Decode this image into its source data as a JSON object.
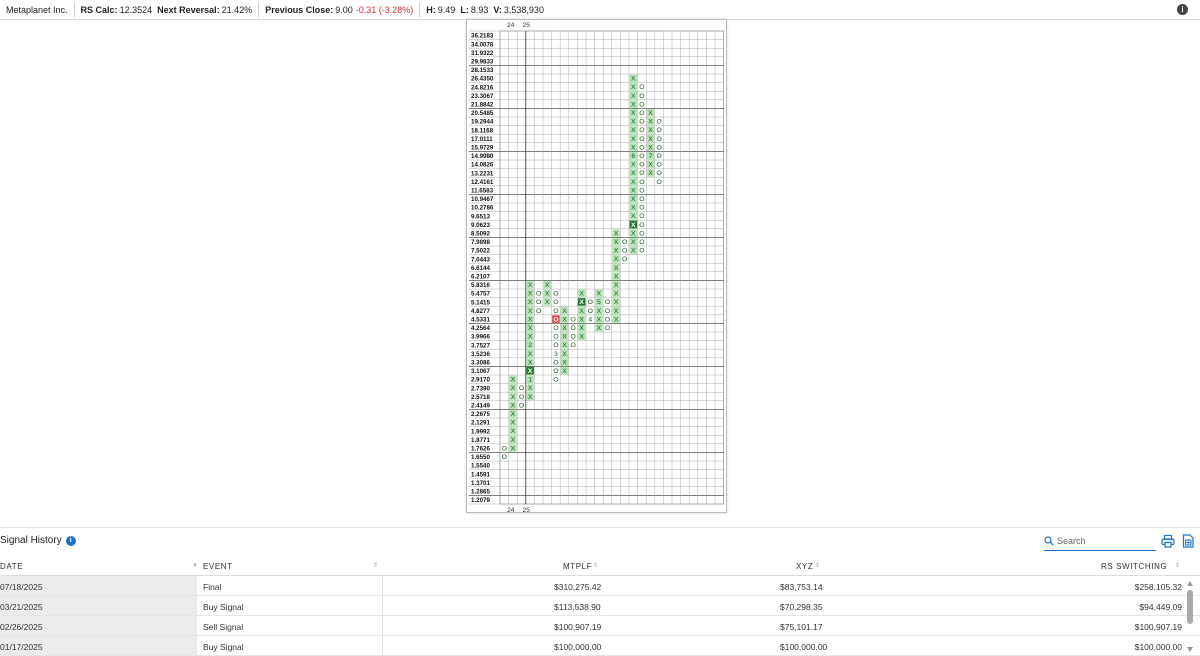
{
  "header": {
    "company": "Metaplanet Inc.",
    "rs_calc_label": "RS Calc:",
    "rs_calc_value": "12.3524",
    "next_reversal_label": "Next Reversal:",
    "next_reversal_value": "21.42%",
    "prev_close_label": "Previous Close:",
    "prev_close_value": "9.00",
    "prev_close_change": "-0.31 (-3.28%)",
    "high_label": "H:",
    "high_value": "9.49",
    "low_label": "L:",
    "low_value": "8.93",
    "volume_label": "V:",
    "volume_value": "3,538,930"
  },
  "chart_data": {
    "type": "point-and-figure",
    "year_labels": [
      "24",
      "25"
    ],
    "price_levels": [
      "36.2183",
      "34.0078",
      "31.9322",
      "29.9833",
      "28.1533",
      "26.4350",
      "24.8216",
      "23.3067",
      "21.8842",
      "20.5485",
      "19.2944",
      "18.1168",
      "17.0111",
      "15.9729",
      "14.9980",
      "14.0826",
      "13.2231",
      "12.4161",
      "11.6583",
      "10.9467",
      "10.2786",
      "9.6513",
      "9.0623",
      "8.5092",
      "7.9898",
      "7.5022",
      "7.0443",
      "6.6144",
      "6.2107",
      "5.8316",
      "5.4757",
      "5.1415",
      "4.8277",
      "4.5331",
      "4.2564",
      "3.9966",
      "3.7527",
      "3.5236",
      "3.3086",
      "3.1067",
      "2.9170",
      "2.7390",
      "2.5718",
      "2.4149",
      "2.2675",
      "2.1291",
      "1.9992",
      "1.8771",
      "1.7626",
      "1.6550",
      "1.5540",
      "1.4591",
      "1.3701",
      "1.2865",
      "1.2079"
    ],
    "columns": [
      {
        "col": 0,
        "type": "O",
        "top": 1.7626,
        "bottom": 1.655
      },
      {
        "col": 1,
        "type": "X",
        "bottom": 1.7626,
        "top": 2.917
      },
      {
        "col": 2,
        "type": "O",
        "top": 2.739,
        "bottom": 2.4149
      },
      {
        "col": 3,
        "type": "X",
        "bottom": 2.5718,
        "top": 5.8316,
        "markers": [
          {
            "price": 3.7527,
            "label": "2"
          },
          {
            "price": 3.1067,
            "label": "X",
            "dark": true
          },
          {
            "price": 2.917,
            "label": "1"
          }
        ]
      },
      {
        "col": 4,
        "type": "O",
        "top": 5.4757,
        "bottom": 4.8277
      },
      {
        "col": 5,
        "type": "X",
        "bottom": 5.1415,
        "top": 5.8316
      },
      {
        "col": 6,
        "type": "O",
        "top": 5.4757,
        "bottom": 2.917,
        "markers": [
          {
            "price": 4.5331,
            "label": "O",
            "red": true
          },
          {
            "price": 3.5236,
            "label": "3"
          }
        ]
      },
      {
        "col": 7,
        "type": "X",
        "bottom": 3.1067,
        "top": 4.8277
      },
      {
        "col": 8,
        "type": "O",
        "top": 4.5331,
        "bottom": 3.7527
      },
      {
        "col": 9,
        "type": "X",
        "bottom": 3.9966,
        "top": 5.4757,
        "markers": [
          {
            "price": 5.1415,
            "label": "X",
            "dark": true
          }
        ]
      },
      {
        "col": 10,
        "type": "O",
        "top": 5.1415,
        "bottom": 4.5331,
        "markers": [
          {
            "price": 4.5331,
            "label": "4"
          }
        ]
      },
      {
        "col": 11,
        "type": "X",
        "bottom": 4.2564,
        "top": 5.4757,
        "markers": [
          {
            "price": 5.1415,
            "label": "5"
          }
        ]
      },
      {
        "col": 12,
        "type": "O",
        "top": 5.1415,
        "bottom": 4.2564
      },
      {
        "col": 13,
        "type": "X",
        "bottom": 4.5331,
        "top": 8.5092
      },
      {
        "col": 14,
        "type": "O",
        "top": 7.9898,
        "bottom": 7.0443
      },
      {
        "col": 15,
        "type": "X",
        "bottom": 7.5022,
        "top": 26.435,
        "markers": [
          {
            "price": 9.0623,
            "label": "X",
            "dark": true
          },
          {
            "price": 14.998,
            "label": "6"
          }
        ]
      },
      {
        "col": 16,
        "type": "O",
        "top": 24.8216,
        "bottom": 7.5022
      },
      {
        "col": 17,
        "type": "X",
        "bottom": 13.2231,
        "top": 20.5485,
        "markers": [
          {
            "price": 14.998,
            "label": "7"
          }
        ]
      },
      {
        "col": 18,
        "type": "O",
        "top": 19.2944,
        "bottom": 12.4161
      }
    ]
  },
  "signal_history": {
    "title": "Signal History",
    "search_placeholder": "Search",
    "columns": [
      "DATE",
      "EVENT",
      "MTPLF",
      "XYZ",
      "RS SWITCHING"
    ],
    "rows": [
      {
        "date": "07/18/2025",
        "event": "Final",
        "mtplf": "$310,275.42",
        "xyz": "$83,753.14",
        "rs": "$258,105.32"
      },
      {
        "date": "03/21/2025",
        "event": "Buy Signal",
        "mtplf": "$113,538.90",
        "xyz": "$70,298.35",
        "rs": "$94,449.09"
      },
      {
        "date": "02/26/2025",
        "event": "Sell Signal",
        "mtplf": "$100,907.19",
        "xyz": "$75,101.17",
        "rs": "$100,907.19"
      },
      {
        "date": "01/17/2025",
        "event": "Buy Signal",
        "mtplf": "$100,000.00",
        "xyz": "$100,000.00",
        "rs": "$100,000.00"
      }
    ]
  },
  "colors": {
    "x_box": "#b8e2b8",
    "dark_box": "#1f7a2e",
    "red_box": "#e04848",
    "accent": "#1a73c7",
    "negative": "#d03030"
  }
}
